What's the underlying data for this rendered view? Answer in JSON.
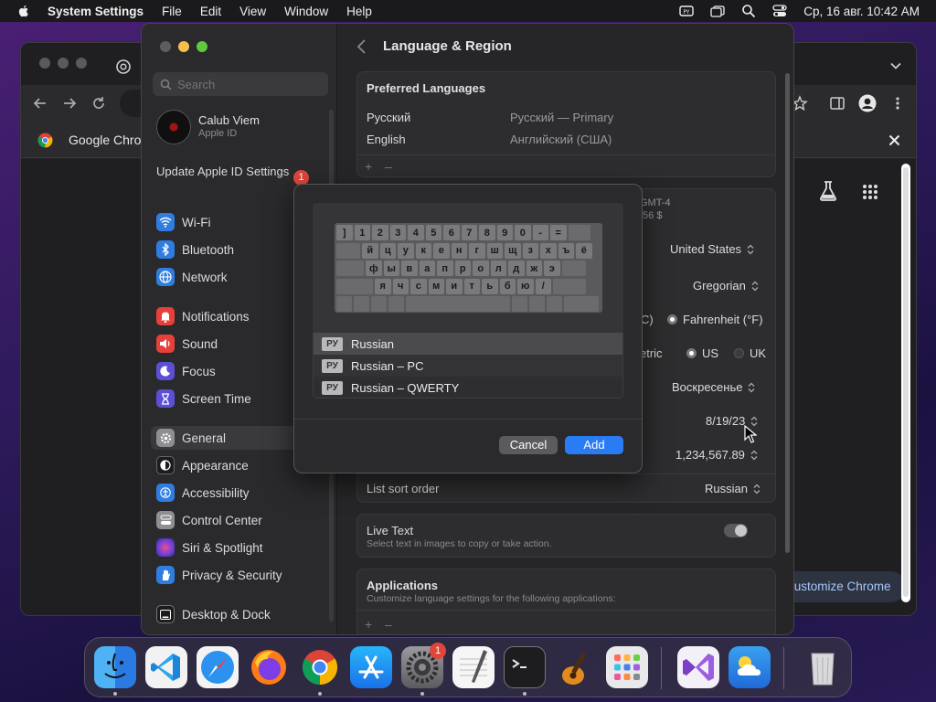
{
  "menubar": {
    "app_name": "System Settings",
    "menus": [
      "File",
      "Edit",
      "View",
      "Window",
      "Help"
    ],
    "clock": "Ср, 16 авг.  10:42 AM"
  },
  "chrome": {
    "bookmark_label": "Google Chrome",
    "customize_label": "Customize Chrome"
  },
  "settings": {
    "search_placeholder": "Search",
    "profile": {
      "name": "Calub Viem",
      "sub": "Apple ID"
    },
    "update_label": "Update Apple ID Settings",
    "update_badge": "1",
    "sidebar_groups": [
      [
        "Wi-Fi",
        "Bluetooth",
        "Network"
      ],
      [
        "Notifications",
        "Sound",
        "Focus",
        "Screen Time"
      ],
      [
        "General",
        "Appearance",
        "Accessibility",
        "Control Center",
        "Siri & Spotlight",
        "Privacy & Security"
      ],
      [
        "Desktop & Dock"
      ]
    ],
    "active_item": "General",
    "page_title": "Language & Region",
    "preferred_languages": {
      "label": "Preferred Languages",
      "rows": [
        {
          "name": "Русский",
          "detail": "Русский — Primary"
        },
        {
          "name": "English",
          "detail": "Английский (США)"
        }
      ]
    },
    "region_fragments": {
      "time_zone": "GMT-4",
      "currency": ",56 $"
    },
    "values": {
      "region": "United States",
      "calendar": "Gregorian",
      "temperature_c": "C)",
      "temperature_f": "Fahrenheit (°F)",
      "measurement_metric": "etric",
      "measurement_us": "US",
      "measurement_uk": "UK",
      "first_day": "Воскресенье",
      "date_format": "8/19/23",
      "number_format": "1,234,567.89"
    },
    "list_sort": {
      "label": "List sort order",
      "value": "Russian"
    },
    "live_text": {
      "label": "Live Text",
      "desc": "Select text in images to copy or take action."
    },
    "applications": {
      "label": "Applications",
      "desc": "Customize language settings for the following applications:"
    }
  },
  "dialog": {
    "keyboard": {
      "row1": [
        "]",
        "1",
        "2",
        "3",
        "4",
        "5",
        "6",
        "7",
        "8",
        "9",
        "0",
        "-",
        "="
      ],
      "row2": [
        "й",
        "ц",
        "у",
        "к",
        "е",
        "н",
        "г",
        "ш",
        "щ",
        "з",
        "х",
        "ъ",
        "ё"
      ],
      "row3": [
        "ф",
        "ы",
        "в",
        "а",
        "п",
        "р",
        "о",
        "л",
        "д",
        "ж",
        "э"
      ],
      "row4": [
        "я",
        "ч",
        "с",
        "м",
        "и",
        "т",
        "ь",
        "б",
        "ю",
        "/"
      ]
    },
    "layouts": [
      {
        "tag": "РУ",
        "name": "Russian"
      },
      {
        "tag": "РУ",
        "name": "Russian – PC"
      },
      {
        "tag": "РУ",
        "name": "Russian – QWERTY"
      }
    ],
    "cancel_label": "Cancel",
    "add_label": "Add"
  },
  "dock": {
    "settings_badge": "1"
  },
  "colors": {
    "accent": "#2a7cf5",
    "badge": "#e0463c"
  }
}
